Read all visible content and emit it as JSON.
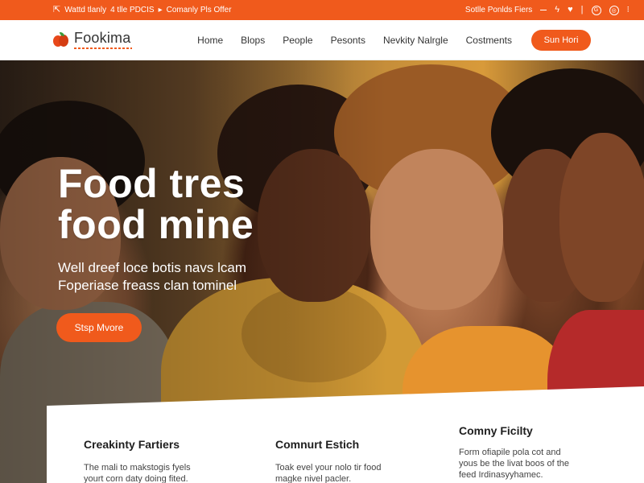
{
  "topbar": {
    "promo_left": "Wattd tlanly",
    "promo_mid": "4 tlle PDCIS",
    "promo_right": "Comanly Pls Offer",
    "link_text": "Sotlle Ponlds Fiers"
  },
  "header": {
    "logo_text": "Fookima",
    "nav": [
      "Home",
      "Blops",
      "People",
      "Pesonts",
      "Nevkity Nalrgle",
      "Costments"
    ],
    "cta_label": "Sun Hori"
  },
  "hero": {
    "title_line1": "Food tres",
    "title_line2": "food mine",
    "subtitle_line1": "Well dreef loce botis navs lcam",
    "subtitle_line2": "Foperiase freass clan tominel",
    "button_label": "Stsp Mvore"
  },
  "features": [
    {
      "title": "Creakinty Fartiers",
      "text_line1": "The mali to makstogis fyels",
      "text_line2": "yourt corn daty doing fited."
    },
    {
      "title": "Comnurt Estich",
      "text_line1": "Toak evel your nolo tir food",
      "text_line2": "magke nivel pacler."
    },
    {
      "title": "Comny Ficilty",
      "text_line1": "Form ofiapile pola cot and",
      "text_line2": "yous be the livat boos of the",
      "text_line3": "feed Irdinasyyhamec."
    }
  ],
  "colors": {
    "accent": "#f05a1c",
    "topbar_bg": "#f05a1c",
    "text_dark": "#1e1e1e"
  },
  "icons": {
    "topbar_left": "share-icon",
    "social": [
      "feather-icon",
      "twitter-icon",
      "google-icon",
      "help-icon",
      "line-icon"
    ]
  }
}
